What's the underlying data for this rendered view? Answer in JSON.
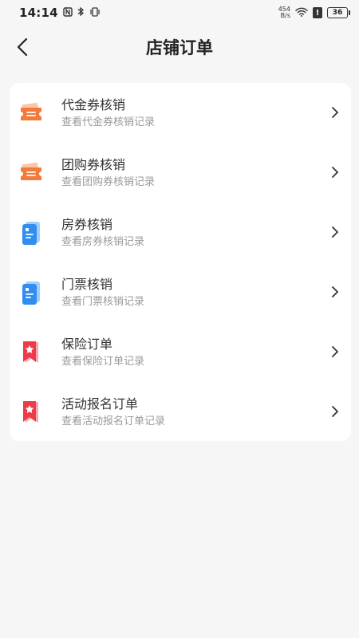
{
  "status_bar": {
    "time": "14:14",
    "net_speed_value": "454",
    "net_speed_unit": "B/s",
    "battery": "36",
    "left_icons": [
      "nfc-icon",
      "bluetooth-icon",
      "vibrate-icon"
    ],
    "right_icons": [
      "wifi-icon",
      "alert-icon",
      "battery-icon"
    ]
  },
  "header": {
    "title": "店铺订单",
    "back_icon": "back-arrow-icon"
  },
  "menu": {
    "items": [
      {
        "title": "代金券核销",
        "subtitle": "查看代金券核销记录",
        "icon": "ticket-icon",
        "color": "#f47a3b"
      },
      {
        "title": "团购券核销",
        "subtitle": "查看团购券核销记录",
        "icon": "ticket-icon",
        "color": "#f47a3b"
      },
      {
        "title": "房券核销",
        "subtitle": "查看房券核销记录",
        "icon": "document-icon",
        "color": "#2f8ef0"
      },
      {
        "title": "门票核销",
        "subtitle": "查看门票核销记录",
        "icon": "document-icon",
        "color": "#2f8ef0"
      },
      {
        "title": "保险订单",
        "subtitle": "查看保险订单记录",
        "icon": "star-bookmark-icon",
        "color": "#ee3b4a"
      },
      {
        "title": "活动报名订单",
        "subtitle": "查看活动报名订单记录",
        "icon": "star-bookmark-icon",
        "color": "#ee3b4a"
      }
    ]
  },
  "colors": {
    "background": "#f6f6f6",
    "card": "#ffffff",
    "title_text": "#333333",
    "subtitle_text": "#999999"
  }
}
